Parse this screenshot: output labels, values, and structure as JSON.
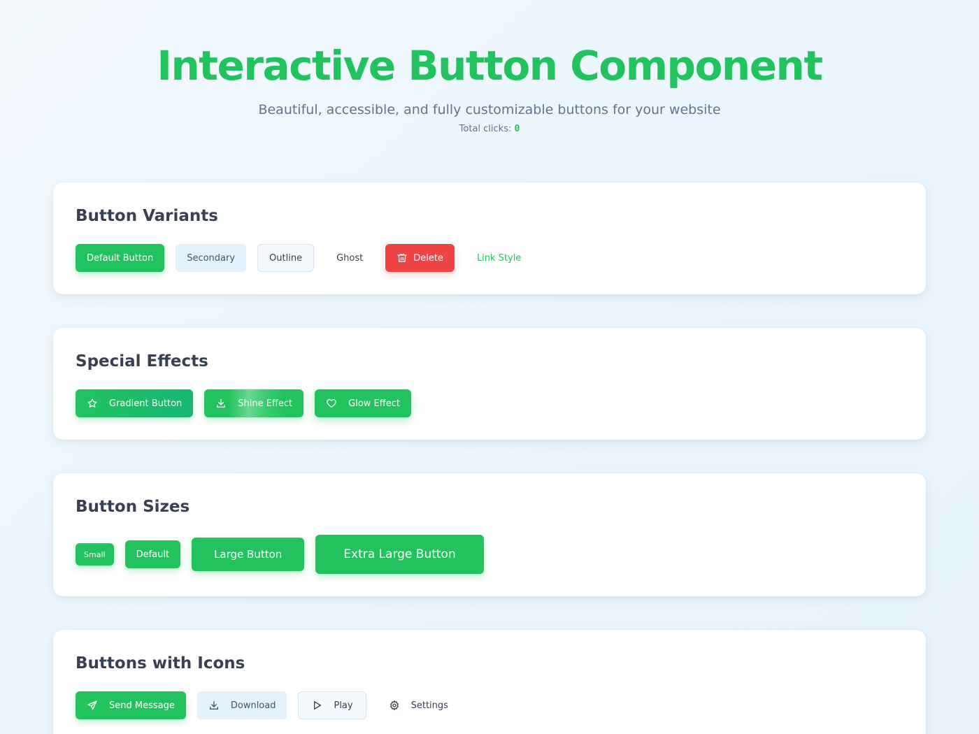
{
  "header": {
    "title": "Interactive Button Component",
    "subtitle": "Beautiful, accessible, and fully customizable buttons for your website",
    "clicks_label": "Total clicks:",
    "clicks_count": "0"
  },
  "sections": {
    "variants": {
      "title": "Button Variants",
      "default_label": "Default Button",
      "secondary_label": "Secondary",
      "outline_label": "Outline",
      "ghost_label": "Ghost",
      "delete_label": "Delete",
      "link_label": "Link Style"
    },
    "effects": {
      "title": "Special Effects",
      "gradient_label": "Gradient Button",
      "shine_label": "Shine Effect",
      "glow_label": "Glow Effect"
    },
    "sizes": {
      "title": "Button Sizes",
      "small_label": "Small",
      "default_label": "Default",
      "large_label": "Large Button",
      "xl_label": "Extra Large Button"
    },
    "icons": {
      "title": "Buttons with Icons",
      "send_label": "Send Message",
      "download_label": "Download",
      "play_label": "Play",
      "settings_label": "Settings"
    }
  },
  "colors": {
    "primary": "#22c35e",
    "danger": "#ef4444",
    "secondary_bg": "#e3f1fd",
    "heading": "#374151"
  },
  "icons": [
    "trash-icon",
    "star-icon",
    "download-icon",
    "heart-icon",
    "send-icon",
    "play-icon",
    "gear-icon"
  ]
}
